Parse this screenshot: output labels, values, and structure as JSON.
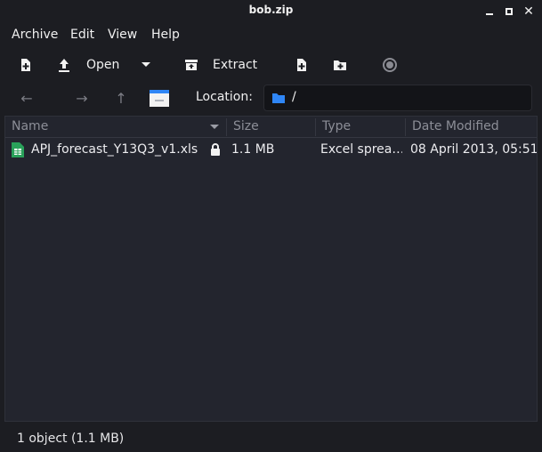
{
  "window": {
    "title": "bob.zip",
    "controls": {
      "minimize_icon": "minimize-icon",
      "maximize_icon": "maximize-icon",
      "close_icon": "close-icon",
      "close_glyph": "✕"
    }
  },
  "menubar": {
    "items": [
      "Archive",
      "Edit",
      "View",
      "Help"
    ]
  },
  "toolbar": {
    "new_icon": "new-archive-icon",
    "open_icon": "upload-icon",
    "open_label": "Open",
    "open_dropdown_icon": "chevron-down-icon",
    "extract_icon": "extract-icon",
    "extract_label": "Extract",
    "add_file_icon": "add-file-icon",
    "add_folder_icon": "add-folder-icon",
    "stop_icon": "stop-icon"
  },
  "location": {
    "back_glyph": "←",
    "forward_glyph": "→",
    "up_glyph": "↑",
    "label": "Location:",
    "path": "/"
  },
  "columns": [
    "Name",
    "Size",
    "Type",
    "Date Modified"
  ],
  "files": [
    {
      "name": "APJ_forecast_Y13Q3_v1.xls",
      "encrypted_icon": "lock-icon",
      "size": "1.1 MB",
      "type": "Excel spreadsheet",
      "type_display": "Excel sprea…",
      "date_modified": "08 April 2013, 05:51"
    }
  ],
  "status": {
    "text": "1 object (1.1 MB)"
  },
  "colors": {
    "background": "#1c1d22",
    "list_background": "#23252e",
    "folder_accent": "#2f86f6",
    "spreadsheet_icon": "#2aa15a"
  }
}
